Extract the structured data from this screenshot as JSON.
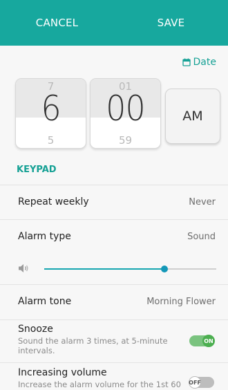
{
  "header": {
    "cancel_label": "CANCEL",
    "save_label": "SAVE"
  },
  "date_link": {
    "label": "Date",
    "icon": "calendar-icon"
  },
  "time_picker": {
    "hour": {
      "prev": "7",
      "current": "6",
      "next": "5"
    },
    "minute": {
      "prev": "01",
      "current": "00",
      "next": "59"
    },
    "period": "AM"
  },
  "keypad_label": "KEYPAD",
  "repeat": {
    "label": "Repeat weekly",
    "value": "Never"
  },
  "alarm_type": {
    "label": "Alarm type",
    "value": "Sound"
  },
  "volume": {
    "icon": "speaker-icon",
    "level": 0.7
  },
  "alarm_tone": {
    "label": "Alarm tone",
    "value": "Morning Flower"
  },
  "snooze": {
    "title": "Snooze",
    "description": "Sound the alarm 3 times, at 5-minute intervals.",
    "state_label": "ON"
  },
  "increasing_volume": {
    "title": "Increasing volume",
    "description": "Increase the alarm volume for the 1st 60",
    "state_label": "OFF"
  },
  "colors": {
    "accent": "#17a89e",
    "toggle_on": "#4caf50",
    "slider": "#1498b8"
  }
}
